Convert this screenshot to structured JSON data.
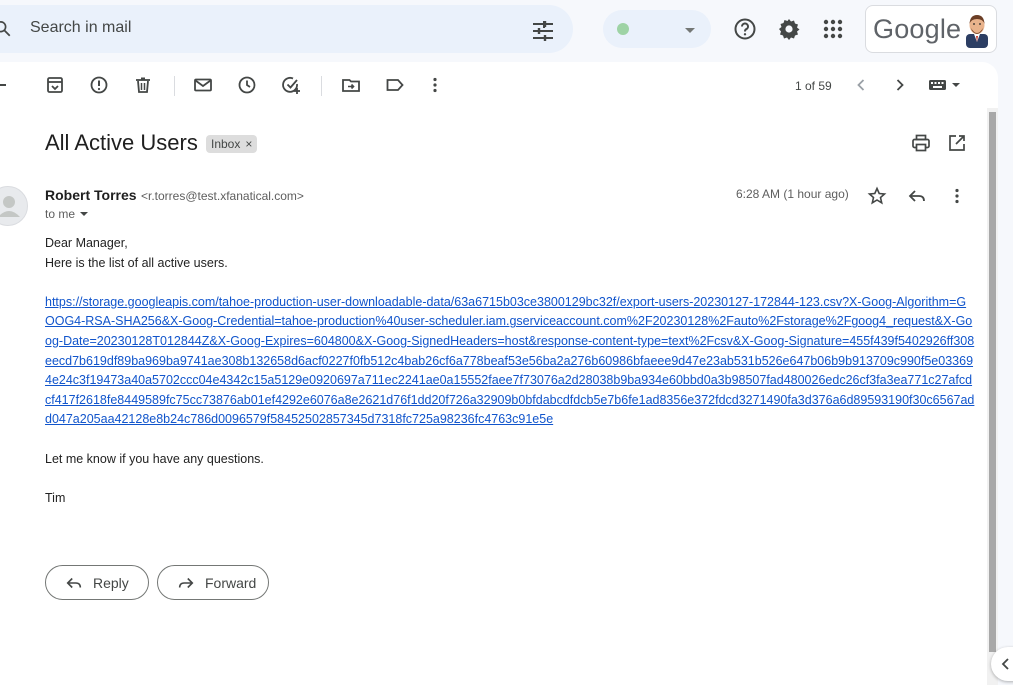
{
  "search": {
    "placeholder": "Search in mail"
  },
  "brand": {
    "logo_text": "Google"
  },
  "toolbar": {
    "pager": "1 of 59"
  },
  "email": {
    "subject": "All Active Users",
    "label": "Inbox",
    "label_close": "×",
    "sender_name": "Robert Torres",
    "sender_email": "<r.torres@test.xfanatical.com>",
    "to": "to me",
    "time": "6:28 AM (1 hour ago)",
    "greeting": "Dear Manager,",
    "intro": "Here is the list of all active users.",
    "link": "https://storage.googleapis.com/tahoe-production-user-downloadable-data/63a6715b03ce3800129bc32f/export-users-20230127-172844-123.csv?X-Goog-Algorithm=GOOG4-RSA-SHA256&X-Goog-Credential=tahoe-production%40user-scheduler.iam.gserviceaccount.com%2F20230128%2Fauto%2Fstorage%2Fgoog4_request&X-Goog-Date=20230128T012844Z&X-Goog-Expires=604800&X-Goog-SignedHeaders=host&response-content-type=text%2Fcsv&X-Goog-Signature=455f439f5402926ff308eecd7b619df89ba969ba9741ae308b132658d6acf0227f0fb512c4bab26cf6a778beaf53e56ba2a276b60986bfaeee9d47e23ab531b526e647b06b9b913709c990f5e033694e24c3f19473a40a5702ccc04e4342c15a5129e0920697a711ec2241ae0a15552faee7f73076a2d28038b9ba934e60bbd0a3b98507fad480026edc26cf3fa3ea771c27afcdcf417f2618fe8449589fc75cc73876ab01ef4292e6076a8e2621d76f1dd20f726a32909b0bfdabcdfdcb5e7b6fe1ad8356e372fdcd3271490fa3d376a6d89593190f30c6567add047a205aa42128e8b24c786d0096579f58452502857345d7318fc725a98236fc4763c91e5e",
    "closing": "Let me know if you have any questions.",
    "signature": "Tim"
  },
  "actions": {
    "reply": "Reply",
    "forward": "Forward"
  }
}
